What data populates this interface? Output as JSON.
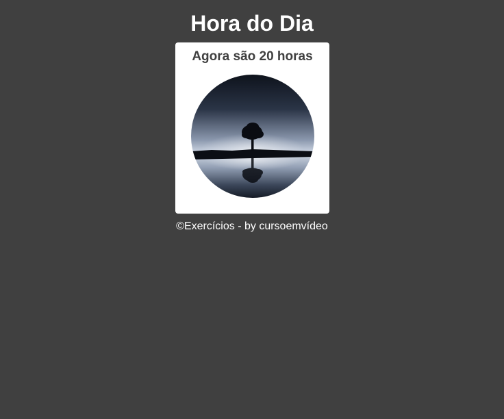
{
  "page": {
    "title": "Hora do Dia",
    "background_color": "#404040"
  },
  "card": {
    "message": "Agora são 20 horas",
    "image_icon": "night-tree-lake-photo"
  },
  "footer": {
    "text": "©Exercícios - by cursoemvídeo"
  }
}
